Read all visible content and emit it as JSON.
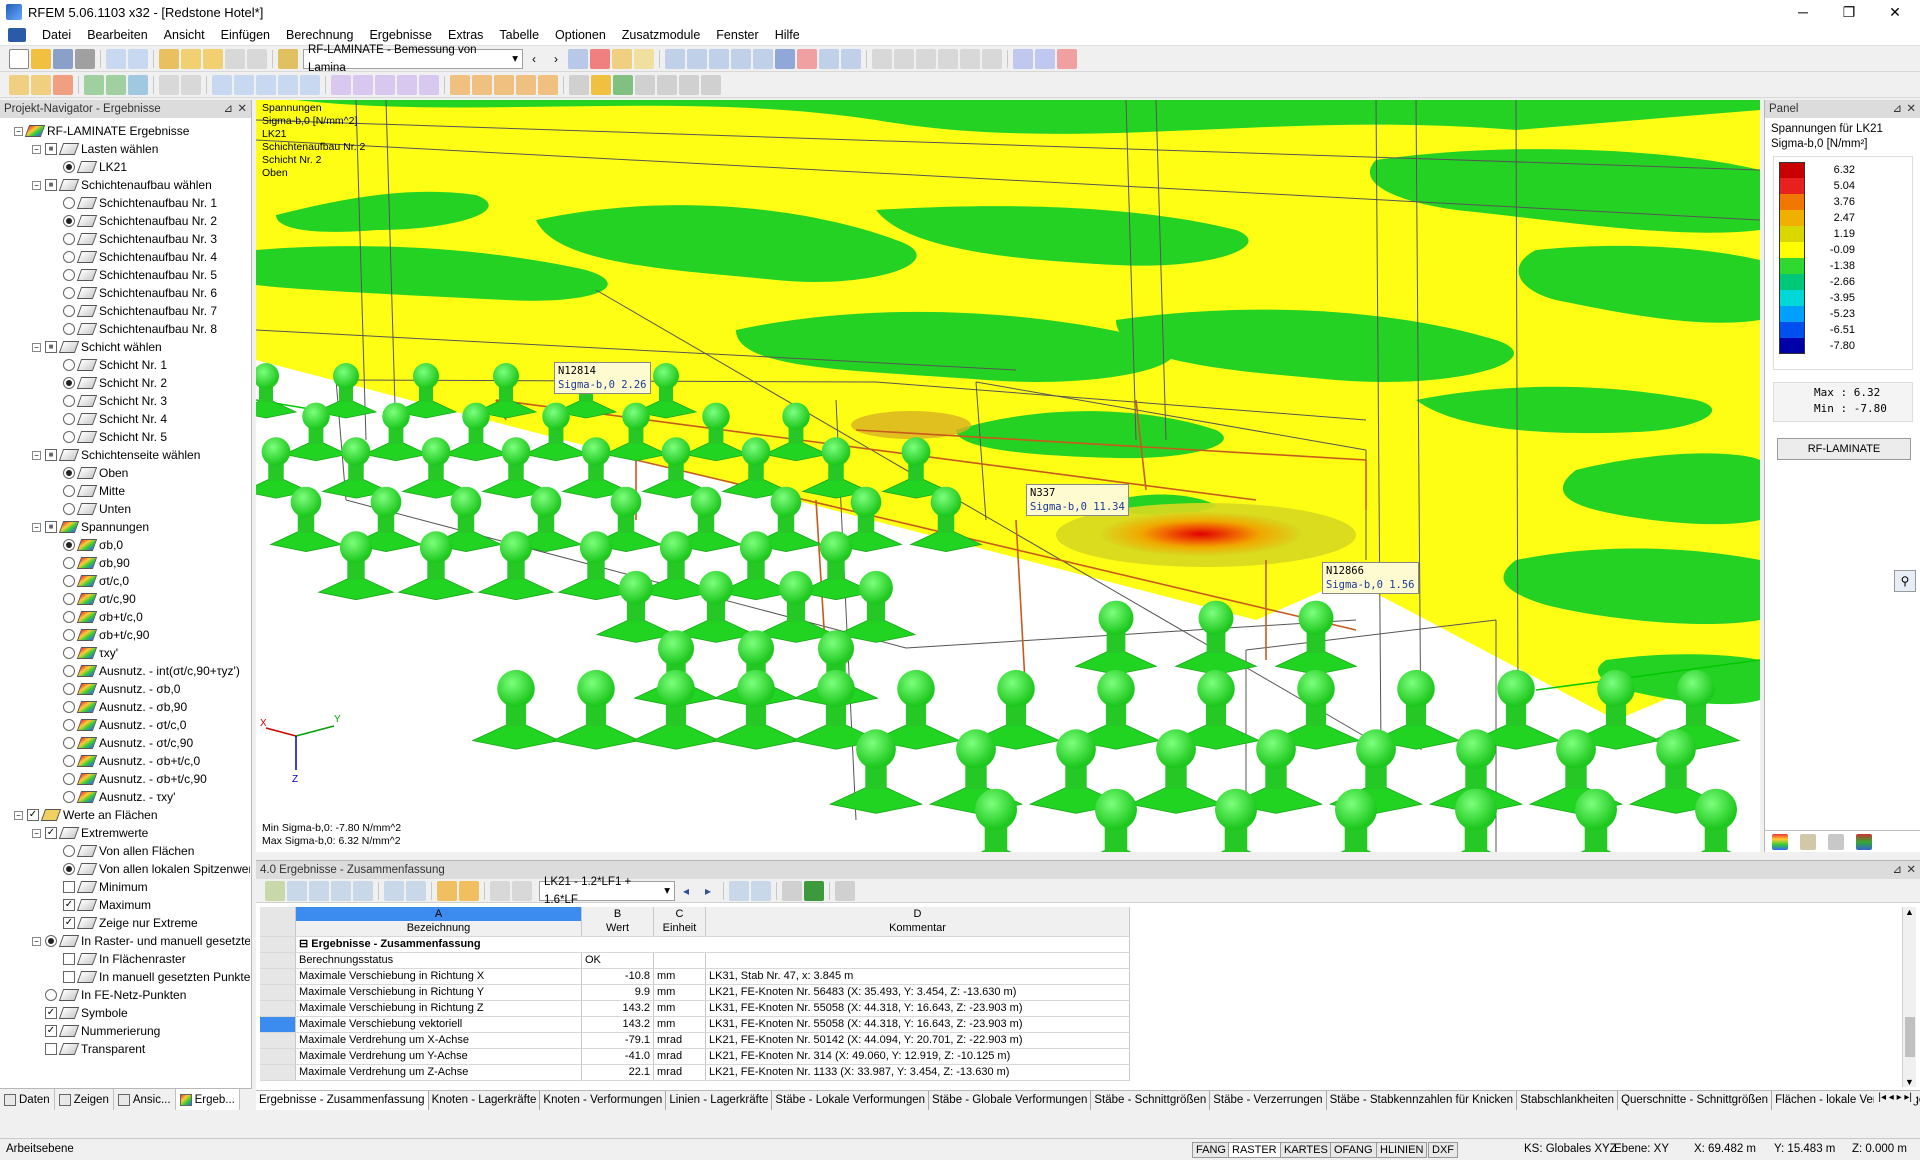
{
  "window": {
    "title": "RFEM 5.06.1103 x32 - [Redstone Hotel*]",
    "minimize": "─",
    "restore": "❐",
    "close": "✕"
  },
  "menu": [
    "Datei",
    "Bearbeiten",
    "Ansicht",
    "Einfügen",
    "Berechnung",
    "Ergebnisse",
    "Extras",
    "Tabelle",
    "Optionen",
    "Zusatzmodule",
    "Fenster",
    "Hilfe"
  ],
  "toolbar": {
    "module_combo": "RF-LAMINATE - Bemessung von Lamina"
  },
  "navigator": {
    "title": "Projekt-Navigator - Ergebnisse",
    "tree": [
      {
        "label": "RF-LAMINATE Ergebnisse",
        "lvl": 0,
        "kind": "root"
      },
      {
        "label": "Lasten wählen",
        "lvl": 1,
        "kind": "grp"
      },
      {
        "label": "LK21",
        "lvl": 2,
        "kind": "radio",
        "on": true
      },
      {
        "label": "Schichtenaufbau wählen",
        "lvl": 1,
        "kind": "grp"
      },
      {
        "label": "Schichtenaufbau Nr. 1",
        "lvl": 2,
        "kind": "radio",
        "on": false
      },
      {
        "label": "Schichtenaufbau Nr. 2",
        "lvl": 2,
        "kind": "radio",
        "on": true
      },
      {
        "label": "Schichtenaufbau Nr. 3",
        "lvl": 2,
        "kind": "radio",
        "on": false
      },
      {
        "label": "Schichtenaufbau Nr. 4",
        "lvl": 2,
        "kind": "radio",
        "on": false
      },
      {
        "label": "Schichtenaufbau Nr. 5",
        "lvl": 2,
        "kind": "radio",
        "on": false
      },
      {
        "label": "Schichtenaufbau Nr. 6",
        "lvl": 2,
        "kind": "radio",
        "on": false
      },
      {
        "label": "Schichtenaufbau Nr. 7",
        "lvl": 2,
        "kind": "radio",
        "on": false
      },
      {
        "label": "Schichtenaufbau Nr. 8",
        "lvl": 2,
        "kind": "radio",
        "on": false
      },
      {
        "label": "Schicht wählen",
        "lvl": 1,
        "kind": "grp"
      },
      {
        "label": "Schicht Nr. 1",
        "lvl": 2,
        "kind": "radio",
        "on": false
      },
      {
        "label": "Schicht Nr. 2",
        "lvl": 2,
        "kind": "radio",
        "on": true
      },
      {
        "label": "Schicht Nr. 3",
        "lvl": 2,
        "kind": "radio",
        "on": false
      },
      {
        "label": "Schicht Nr. 4",
        "lvl": 2,
        "kind": "radio",
        "on": false
      },
      {
        "label": "Schicht Nr. 5",
        "lvl": 2,
        "kind": "radio",
        "on": false
      },
      {
        "label": "Schichtenseite wählen",
        "lvl": 1,
        "kind": "grp"
      },
      {
        "label": "Oben",
        "lvl": 2,
        "kind": "radio",
        "on": true
      },
      {
        "label": "Mitte",
        "lvl": 2,
        "kind": "radio",
        "on": false
      },
      {
        "label": "Unten",
        "lvl": 2,
        "kind": "radio",
        "on": false
      },
      {
        "label": "Spannungen",
        "lvl": 1,
        "kind": "grp"
      },
      {
        "label": "σb,0",
        "lvl": 2,
        "kind": "radio",
        "on": true
      },
      {
        "label": "σb,90",
        "lvl": 2,
        "kind": "radio",
        "on": false
      },
      {
        "label": "σt/c,0",
        "lvl": 2,
        "kind": "radio",
        "on": false
      },
      {
        "label": "σt/c,90",
        "lvl": 2,
        "kind": "radio",
        "on": false
      },
      {
        "label": "σb+t/c,0",
        "lvl": 2,
        "kind": "radio",
        "on": false
      },
      {
        "label": "σb+t/c,90",
        "lvl": 2,
        "kind": "radio",
        "on": false
      },
      {
        "label": "τxy'",
        "lvl": 2,
        "kind": "radio",
        "on": false
      },
      {
        "label": "Ausnutz. - int(σt/c,90+τyz')",
        "lvl": 2,
        "kind": "radio",
        "on": false
      },
      {
        "label": "Ausnutz. - σb,0",
        "lvl": 2,
        "kind": "radio",
        "on": false
      },
      {
        "label": "Ausnutz. - σb,90",
        "lvl": 2,
        "kind": "radio",
        "on": false
      },
      {
        "label": "Ausnutz. - σt/c,0",
        "lvl": 2,
        "kind": "radio",
        "on": false
      },
      {
        "label": "Ausnutz. - σt/c,90",
        "lvl": 2,
        "kind": "radio",
        "on": false
      },
      {
        "label": "Ausnutz. - σb+t/c,0",
        "lvl": 2,
        "kind": "radio",
        "on": false
      },
      {
        "label": "Ausnutz. - σb+t/c,90",
        "lvl": 2,
        "kind": "radio",
        "on": false
      },
      {
        "label": "Ausnutz. - τxy'",
        "lvl": 2,
        "kind": "radio",
        "on": false
      },
      {
        "label": "Werte an Flächen",
        "lvl": 0,
        "kind": "chk",
        "on": true
      },
      {
        "label": "Extremwerte",
        "lvl": 1,
        "kind": "chkgrp",
        "on": true
      },
      {
        "label": "Von allen Flächen",
        "lvl": 2,
        "kind": "radio",
        "on": false
      },
      {
        "label": "Von allen lokalen Spitzenwer",
        "lvl": 2,
        "kind": "radio",
        "on": true
      },
      {
        "label": "Minimum",
        "lvl": 2,
        "kind": "chk",
        "on": false
      },
      {
        "label": "Maximum",
        "lvl": 2,
        "kind": "chk",
        "on": true
      },
      {
        "label": "Zeige nur Extreme",
        "lvl": 2,
        "kind": "chk",
        "on": true
      },
      {
        "label": "In Raster- und manuell gesetzte",
        "lvl": 1,
        "kind": "radiogrp",
        "on": true
      },
      {
        "label": "In Flächenraster",
        "lvl": 2,
        "kind": "chk",
        "on": false
      },
      {
        "label": "In manuell gesetzten Punkte",
        "lvl": 2,
        "kind": "chk",
        "on": false
      },
      {
        "label": "In FE-Netz-Punkten",
        "lvl": 1,
        "kind": "radio",
        "on": false
      },
      {
        "label": "Symbole",
        "lvl": 1,
        "kind": "chk",
        "on": true
      },
      {
        "label": "Nummerierung",
        "lvl": 1,
        "kind": "chk",
        "on": true
      },
      {
        "label": "Transparent",
        "lvl": 1,
        "kind": "chk",
        "on": false
      }
    ],
    "tabs": [
      "Daten",
      "Zeigen",
      "Ansic...",
      "Ergeb..."
    ]
  },
  "viewport": {
    "info": [
      "Spannungen",
      "Sigma-b,0 [N/mm^2]",
      "LK21",
      "Schichtenaufbau Nr. 2",
      "Schicht Nr. 2",
      "Oben"
    ],
    "min_text": "Min Sigma-b,0: -7.80 N/mm^2",
    "max_text": "Max Sigma-b,0: 6.32 N/mm^2",
    "labels": [
      {
        "node": "N12814",
        "val": "Sigma-b,0  2.26"
      },
      {
        "node": "N337",
        "val": "Sigma-b,0  11.34"
      },
      {
        "node": "N12866",
        "val": "Sigma-b,0  1.56"
      }
    ],
    "axes": {
      "x": "X",
      "y": "Y",
      "z": "Z"
    }
  },
  "panel": {
    "title": "Panel",
    "subtitle": "Spannungen für LK21",
    "unit": "Sigma-b,0 [N/mm²]",
    "legend": [
      {
        "v": "6.32",
        "c": "#c80000"
      },
      {
        "v": "5.04",
        "c": "#e82020"
      },
      {
        "v": "3.76",
        "c": "#f07800"
      },
      {
        "v": "2.47",
        "c": "#f0b000"
      },
      {
        "v": "1.19",
        "c": "#d8d800"
      },
      {
        "v": "-0.09",
        "c": "#ffff00"
      },
      {
        "v": "-1.38",
        "c": "#30d830"
      },
      {
        "v": "-2.66",
        "c": "#00c878"
      },
      {
        "v": "-3.95",
        "c": "#00d8d8"
      },
      {
        "v": "-5.23",
        "c": "#00a0ff"
      },
      {
        "v": "-6.51",
        "c": "#0050f0"
      },
      {
        "v": "-7.80",
        "c": "#0000a8"
      }
    ],
    "max_label": "Max  :",
    "max_val": "6.32",
    "min_label": "Min  :",
    "min_val": "-7.80",
    "button": "RF-LAMINATE"
  },
  "results": {
    "title": "4.0 Ergebnisse - Zusammenfassung",
    "lc_combo": "LK21 - 1.2*LF1 + 1.6*LF",
    "col_letters": [
      "A",
      "B",
      "C",
      "D"
    ],
    "col_names": [
      "Bezeichnung",
      "Wert",
      "Einheit",
      "Kommentar"
    ],
    "group": "Ergebnisse - Zusammenfassung",
    "rows": [
      {
        "a": "Berechnungsstatus",
        "b": "OK",
        "bl": true,
        "c": "",
        "d": ""
      },
      {
        "a": "Maximale Verschiebung in Richtung X",
        "b": "-10.8",
        "c": "mm",
        "d": "LK31, Stab Nr. 47, x: 3.845 m"
      },
      {
        "a": "Maximale Verschiebung in Richtung Y",
        "b": "9.9",
        "c": "mm",
        "d": "LK21, FE-Knoten Nr. 56483 (X: 35.493, Y: 3.454, Z: -13.630 m)"
      },
      {
        "a": "Maximale Verschiebung in Richtung Z",
        "b": "143.2",
        "c": "mm",
        "d": "LK31, FE-Knoten Nr. 55058 (X: 44.318, Y: 16.643, Z: -23.903 m)"
      },
      {
        "a": "Maximale Verschiebung vektoriell",
        "b": "143.2",
        "c": "mm",
        "d": "LK31, FE-Knoten Nr. 55058 (X: 44.318, Y: 16.643, Z: -23.903 m)",
        "sel": true
      },
      {
        "a": "Maximale Verdrehung um X-Achse",
        "b": "-79.1",
        "c": "mrad",
        "d": "LK21, FE-Knoten Nr. 50142 (X: 44.094, Y: 20.701, Z: -22.903 m)"
      },
      {
        "a": "Maximale Verdrehung um Y-Achse",
        "b": "-41.0",
        "c": "mrad",
        "d": "LK21, FE-Knoten Nr. 314 (X: 49.060, Y: 12.919, Z: -10.125 m)"
      },
      {
        "a": "Maximale Verdrehung um Z-Achse",
        "b": "22.1",
        "c": "mrad",
        "d": "LK21, FE-Knoten Nr. 1133 (X: 33.987, Y: 3.454, Z: -13.630 m)"
      }
    ],
    "tabs": [
      "Ergebnisse - Zusammenfassung",
      "Knoten - Lagerkräfte",
      "Knoten - Verformungen",
      "Linien - Lagerkräfte",
      "Stäbe - Lokale Verformungen",
      "Stäbe - Globale Verformungen",
      "Stäbe - Schnittgrößen",
      "Stäbe - Verzerrungen",
      "Stäbe - Stabkennzahlen für Knicken",
      "Stabschlankheiten",
      "Querschnitte - Schnittgrößen",
      "Flächen - lokale Verformungen"
    ]
  },
  "status": {
    "left": "Arbeitsebene",
    "buttons": [
      "FANG",
      "RASTER",
      "KARTES",
      "OFANG",
      "HLINIEN",
      "DXF"
    ],
    "ks": "KS: Globales XYZ",
    "ebene": "Ebene: XY",
    "x": "X:  69.482 m",
    "y": "Y:  15.483 m",
    "z": "Z:  0.000 m"
  }
}
